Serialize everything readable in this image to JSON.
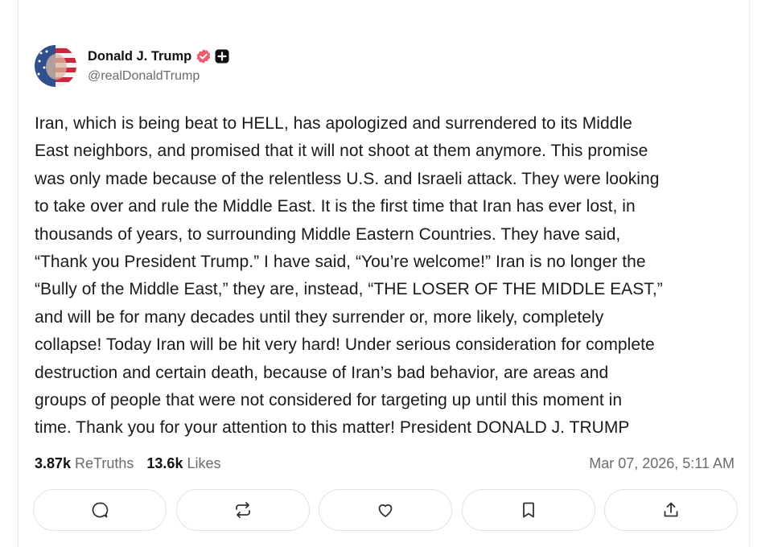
{
  "author": {
    "display_name": "Donald J. Trump",
    "handle": "@realDonaldTrump",
    "verified_icon": "verified-badge-icon",
    "extra_badge_icon": "plus-badge-icon",
    "verified_color": "#ee5a6f"
  },
  "post": {
    "lines": [
      "Iran, which is being beat to HELL, has apologized and surrendered to its Middle",
      "East neighbors, and promised that it will not shoot at them anymore. This promise",
      "was only made because of the relentless U.S. and Israeli attack. They were looking",
      "to take over and rule the Middle East. It is the first time that Iran has ever lost, in",
      "thousands of years, to surrounding Middle Eastern Countries. They have said,",
      "“Thank you President Trump.” I have said, “You’re welcome!” Iran is no longer the",
      "“Bully of the Middle East,” they are, instead, “THE LOSER OF THE MIDDLE EAST,”",
      "and will be for many decades until they surrender or, more likely, completely",
      "collapse! Today Iran will be hit very hard! Under serious consideration for complete",
      "destruction and certain death, because of Iran’s bad behavior, are areas and",
      "groups of people that were not considered for targeting up until this moment in",
      "time. Thank you for your attention to this matter! President DONALD J. TRUMP"
    ]
  },
  "stats": {
    "retruths_count": "3.87k",
    "retruths_label": "ReTruths",
    "likes_count": "13.6k",
    "likes_label": "Likes",
    "timestamp": "Mar 07, 2026, 5:11 AM"
  },
  "actions": {
    "icons": [
      "reply-icon",
      "retruth-icon",
      "like-icon",
      "bookmark-icon",
      "share-icon"
    ]
  },
  "colors": {
    "text": "#111111",
    "muted": "#6b6b6b",
    "border": "#e2e2e2"
  }
}
